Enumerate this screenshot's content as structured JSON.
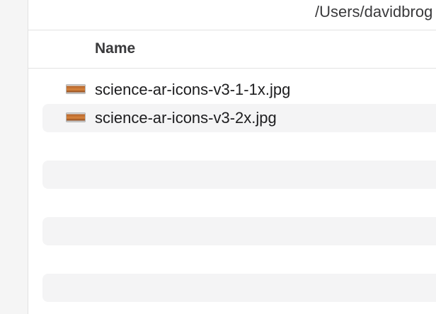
{
  "pathbar": {
    "path": "/Users/davidbrog"
  },
  "header": {
    "name_column": "Name"
  },
  "files": [
    {
      "name": "science-ar-icons-v3-1-1x.jpg",
      "icon": "jpg-image-icon"
    },
    {
      "name": "science-ar-icons-v3-2x.jpg",
      "icon": "jpg-image-icon"
    }
  ]
}
